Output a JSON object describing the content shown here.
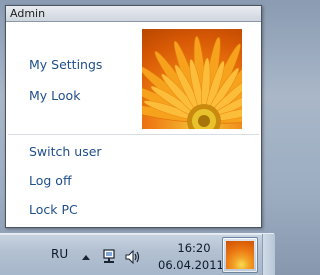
{
  "popup": {
    "title": "Admin",
    "items": {
      "my_settings": "My Settings",
      "my_look": "My Look"
    },
    "actions": {
      "switch_user": "Switch user",
      "log_off": "Log off",
      "lock_pc": "Lock PC"
    },
    "avatar_icon": "orange-gerbera-flower-picture",
    "link_color": "#1f4e8c"
  },
  "taskbar": {
    "language": "RU",
    "tray_icons": [
      "chevron-up-icon",
      "network-icon",
      "speaker-icon"
    ],
    "clock_time": "16:20",
    "clock_date": "06.04.2011",
    "running_app_icon": "user-picture-thumbnail"
  }
}
